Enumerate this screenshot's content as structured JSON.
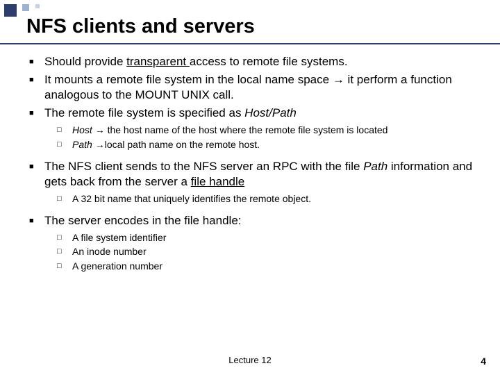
{
  "title": "NFS clients and servers",
  "b1": {
    "pre": "Should provide ",
    "u": "transparent ",
    "post": "access to remote file systems."
  },
  "b2": {
    "pre": "It mounts a remote file system in the local name space ",
    "arrow": "→",
    "post": " it perform a function analogous to the MOUNT UNIX call."
  },
  "b3": {
    "pre": "The remote file system is specified as ",
    "it": "Host/Path"
  },
  "b3a": {
    "it": "Host ",
    "arrow": "→",
    "post": " the host name of the host where the remote file system is located"
  },
  "b3b": {
    "it": "Path  ",
    "arrow": "→",
    "post": "local path name on the remote host."
  },
  "b4": {
    "pre": "The NFS client sends to the NFS server an RPC with the file ",
    "it": "Path",
    "mid": " information  and gets back from the server a ",
    "u": "file handle"
  },
  "b4a": "A 32 bit name that uniquely identifies the remote object.",
  "b5": "The server encodes in the file handle:",
  "b5a": "A file system identifier",
  "b5b": "An inode number",
  "b5c": "A generation number",
  "footer_center": "Lecture 12",
  "footer_right": "4",
  "glyphs": {
    "solid_square": "■",
    "hollow_square": "□"
  }
}
